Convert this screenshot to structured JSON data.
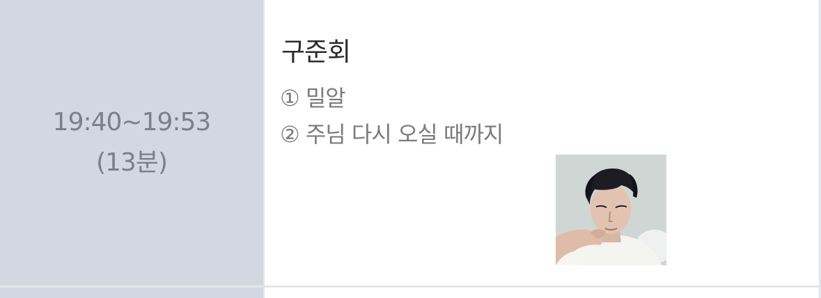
{
  "schedule_row": {
    "time_range": "19:40~19:53",
    "duration": "(13분)",
    "performer": "구준회",
    "songs": [
      "① 밀알",
      "② 주님 다시 오실 때까지"
    ]
  },
  "colors": {
    "time_cell_bg": "#d3d7e2",
    "content_bg": "#ffffff",
    "time_text": "#7a7f8c",
    "performer_text": "#2b2b2b",
    "song_text": "#7b7b7b"
  }
}
